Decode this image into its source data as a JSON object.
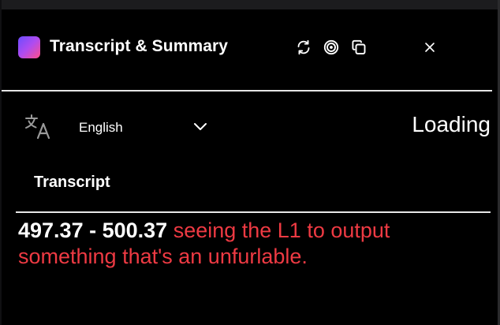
{
  "window": {
    "title": "Transcript & Summary",
    "logo_icon": "app-logo-gradient",
    "buttons": [
      {
        "name": "refresh",
        "icon": "refresh-icon"
      },
      {
        "name": "target",
        "icon": "target-icon"
      },
      {
        "name": "copy",
        "icon": "copy-icon"
      },
      {
        "name": "close",
        "icon": "close-icon"
      }
    ]
  },
  "language": {
    "icon": "translate-icon",
    "selected": "English",
    "dropdown_icon": "chevron-down-icon"
  },
  "status": "Loading",
  "transcript": {
    "heading": "Transcript",
    "segments": [
      {
        "timestamp": "497.37 - 500.37",
        "text": "seeing the L1 to output something that's an unfurlable."
      }
    ]
  },
  "colors": {
    "background": "#000000",
    "text": "#ffffff",
    "segment_text": "#ee3a43",
    "divider": "#e6e6e6",
    "logo_gradient_start": "#6b4cff",
    "logo_gradient_end": "#ff4f8a"
  }
}
